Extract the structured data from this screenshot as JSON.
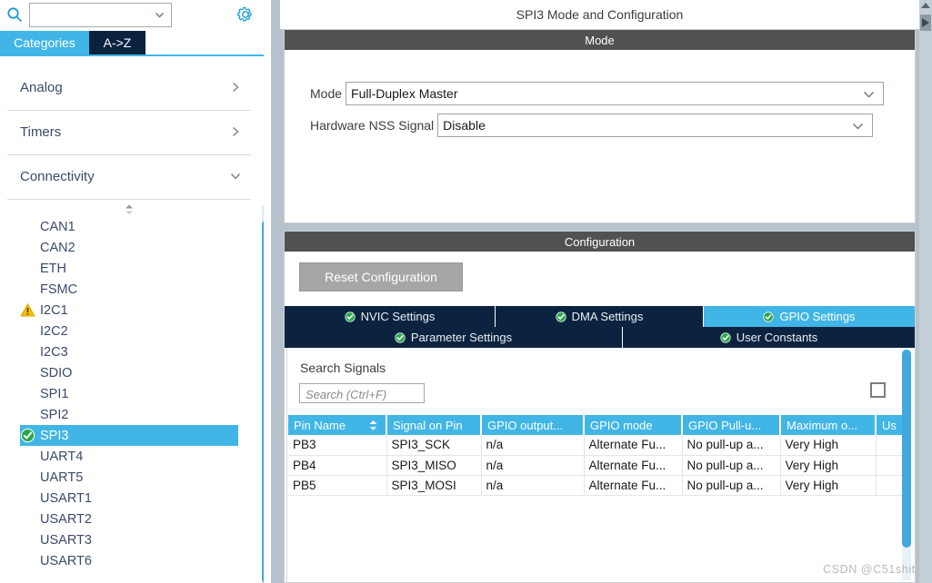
{
  "sidebar": {
    "search": {
      "value": "",
      "placeholder": "",
      "icon": "search-icon"
    },
    "settings_icon": "gear-icon",
    "tabs": [
      {
        "label": "Categories",
        "active": true
      },
      {
        "label": "A->Z",
        "active": false
      }
    ],
    "groups": [
      {
        "label": "Analog",
        "expanded": false,
        "chevron": "chevron-right-icon"
      },
      {
        "label": "Timers",
        "expanded": false,
        "chevron": "chevron-right-icon"
      },
      {
        "label": "Connectivity",
        "expanded": true,
        "chevron": "chevron-down-icon"
      }
    ],
    "peripherals": [
      {
        "label": "CAN1",
        "status": "none"
      },
      {
        "label": "CAN2",
        "status": "none"
      },
      {
        "label": "ETH",
        "status": "none"
      },
      {
        "label": "FSMC",
        "status": "none"
      },
      {
        "label": "I2C1",
        "status": "warning"
      },
      {
        "label": "I2C2",
        "status": "none"
      },
      {
        "label": "I2C3",
        "status": "none"
      },
      {
        "label": "SDIO",
        "status": "none"
      },
      {
        "label": "SPI1",
        "status": "none"
      },
      {
        "label": "SPI2",
        "status": "none"
      },
      {
        "label": "SPI3",
        "status": "ok",
        "selected": true
      },
      {
        "label": "UART4",
        "status": "none"
      },
      {
        "label": "UART5",
        "status": "none"
      },
      {
        "label": "USART1",
        "status": "none"
      },
      {
        "label": "USART2",
        "status": "none"
      },
      {
        "label": "USART3",
        "status": "none"
      },
      {
        "label": "USART6",
        "status": "none"
      }
    ]
  },
  "main": {
    "title": "SPI3 Mode and Configuration",
    "mode_section": {
      "header": "Mode",
      "fields": [
        {
          "label": "Mode",
          "value": "Full-Duplex Master"
        },
        {
          "label": "Hardware NSS Signal",
          "value": "Disable"
        }
      ]
    },
    "configuration_section": {
      "header": "Configuration",
      "reset_button": "Reset Configuration",
      "tabs_row1": [
        {
          "label": "NVIC Settings",
          "active": false
        },
        {
          "label": "DMA Settings",
          "active": false
        },
        {
          "label": "GPIO Settings",
          "active": true
        }
      ],
      "tabs_row2": [
        {
          "label": "Parameter Settings",
          "active": false
        },
        {
          "label": "User Constants",
          "active": false
        }
      ],
      "search_signals": {
        "label": "Search Signals",
        "placeholder": "Search (Ctrl+F)",
        "value": "",
        "checkbox_checked": false
      },
      "pin_table": {
        "columns": [
          "Pin Name",
          "Signal on Pin",
          "GPIO output...",
          "GPIO mode",
          "GPIO Pull-u...",
          "Maximum o...",
          "Us"
        ],
        "sorted_column": "Pin Name",
        "rows": [
          [
            "PB3",
            "SPI3_SCK",
            "n/a",
            "Alternate Fu...",
            "No pull-up a...",
            "Very High",
            ""
          ],
          [
            "PB4",
            "SPI3_MISO",
            "n/a",
            "Alternate Fu...",
            "No pull-up a...",
            "Very High",
            ""
          ],
          [
            "PB5",
            "SPI3_MOSI",
            "n/a",
            "Alternate Fu...",
            "No pull-up a...",
            "Very High",
            ""
          ]
        ]
      }
    }
  },
  "watermark": "CSDN @C51shit",
  "colors": {
    "accent_blue": "#41b6e6",
    "tab_navy": "#0c2340",
    "section_header_grey": "#515151",
    "warning_yellow": "#f2c000",
    "ok_green": "#28a745",
    "panel_border": "#b6c2cc"
  }
}
